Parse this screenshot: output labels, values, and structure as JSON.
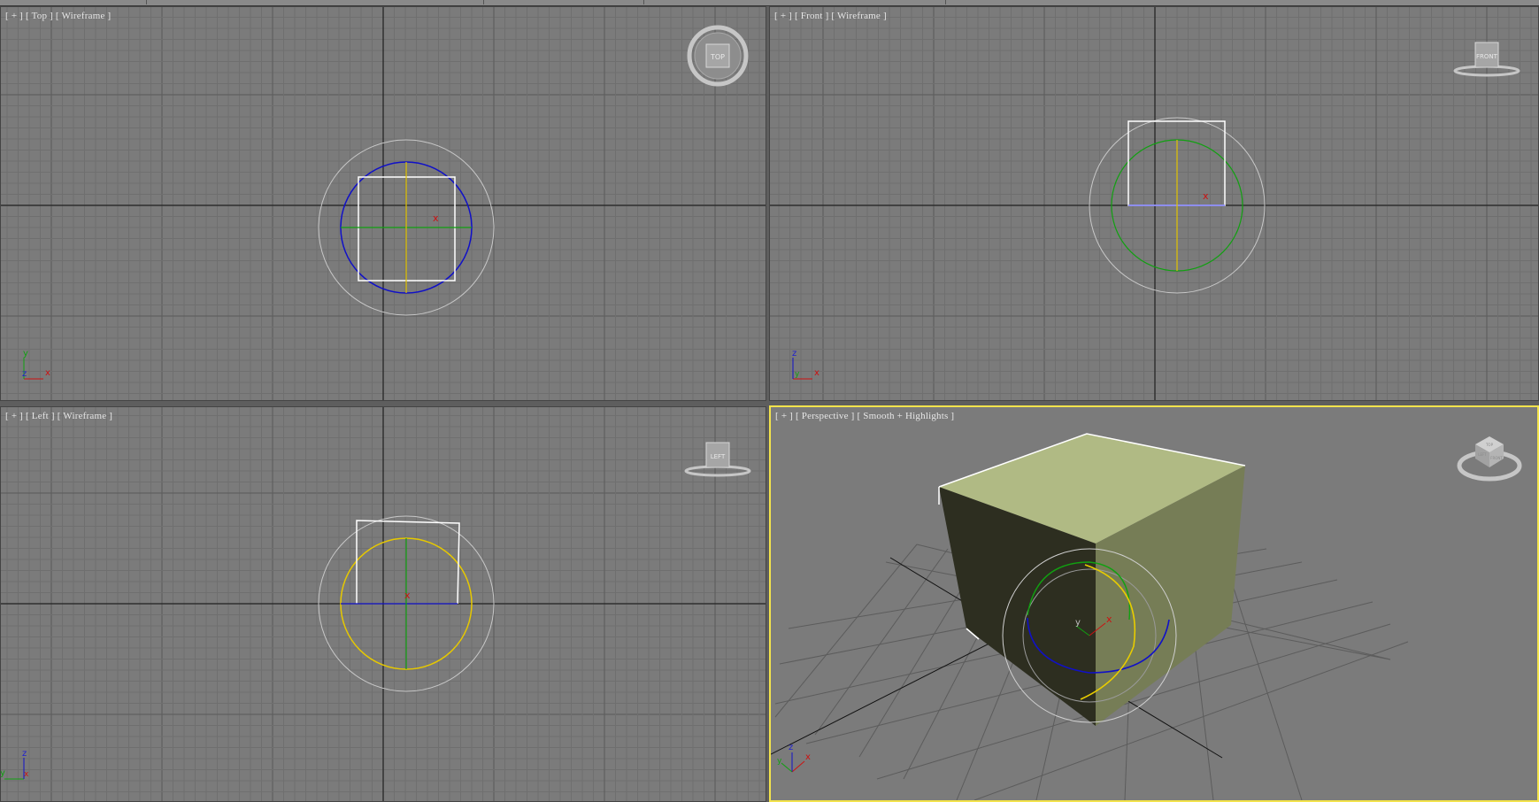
{
  "viewports": {
    "top": {
      "menu": "[ + ]",
      "view": "[ Top ]",
      "shading": "[ Wireframe ]",
      "nav_label": "TOP",
      "axis_x": "x",
      "axis_y": "y",
      "axis_z": "z"
    },
    "front": {
      "menu": "[ + ]",
      "view": "[ Front ]",
      "shading": "[ Wireframe ]",
      "nav_label": "FRONT",
      "axis_x": "x",
      "axis_z": "z",
      "axis_y": "y"
    },
    "left": {
      "menu": "[ + ]",
      "view": "[ Left ]",
      "shading": "[ Wireframe ]",
      "nav_label": "LEFT",
      "axis_y": "y",
      "axis_z": "z",
      "axis_x": "x"
    },
    "perspective": {
      "menu": "[ + ]",
      "view": "[ Perspective ]",
      "shading": "[ Smooth + Highlights ]",
      "axis_x": "x",
      "axis_y": "y",
      "axis_z": "z",
      "cube_top": "TOP",
      "cube_front": "FRONT",
      "cube_left": "LEFT"
    }
  },
  "gizmo_labels": {
    "x": "x",
    "y": "y",
    "z": "z"
  },
  "colors": {
    "viewport_bg": "#7b7b7b",
    "grid_minor": "#6f6f6f",
    "grid_major": "#5f5f5f",
    "axis_line": "#111111",
    "active_border": "#f3e34c",
    "gizmo_x": "#cc1111",
    "gizmo_y": "#11a011",
    "gizmo_z": "#1010c8",
    "gizmo_highlight": "#f0d000",
    "cube_top": "#b0ba84",
    "cube_right": "#767d56",
    "cube_left": "#2d2e20"
  },
  "active_viewport": "perspective"
}
